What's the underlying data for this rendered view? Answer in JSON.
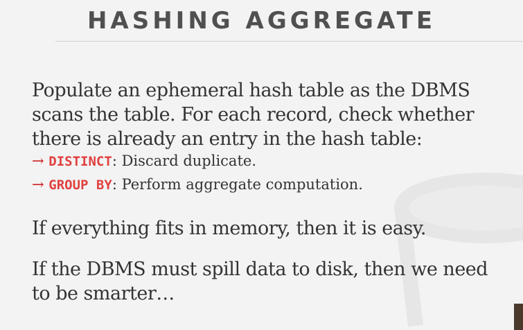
{
  "slide": {
    "title": "HASHING AGGREGATE",
    "intro": "Populate an ephemeral hash table as the DBMS scans the table. For each record, check whether there is already an entry in the hash table:",
    "bullets": [
      {
        "arrow": "→",
        "keyword": "DISTINCT",
        "text": ": Discard duplicate."
      },
      {
        "arrow": "→",
        "keyword": "GROUP BY",
        "text": ": Perform aggregate computation."
      }
    ],
    "para2": "If everything fits in memory, then it is easy.",
    "para3_line1": "If the DBMS must spill data to disk, then we need",
    "para3_line2": "to be smarter…"
  },
  "colors": {
    "background": "#f3f3f3",
    "title": "#505050",
    "body_text": "#333333",
    "keyword": "#e04040",
    "arrow": "#cc2222"
  }
}
